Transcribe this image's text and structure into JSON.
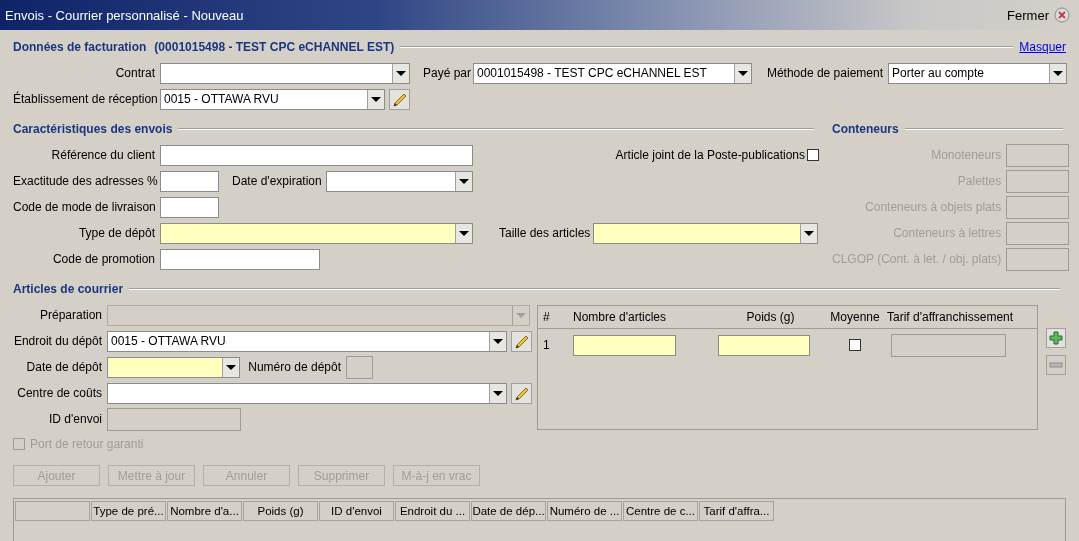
{
  "window": {
    "title": "Envois - Courrier personnalisé - Nouveau",
    "close_label": "Fermer"
  },
  "billing": {
    "heading": "Données de facturation",
    "account": "(0001015498 - TEST CPC eCHANNEL EST)",
    "hide_link": "Masquer",
    "fields": [
      {
        "label": "Contrat",
        "kind": "combo",
        "required": false,
        "disabled": false
      },
      {
        "label": "Payé par",
        "kind": "combo",
        "value": "0001015498 - TEST CPC eCHANNEL EST",
        "required": false,
        "disabled": false
      },
      {
        "label": "Méthode de paiement",
        "kind": "combo",
        "value": "Porter au compte",
        "required": false,
        "disabled": false
      },
      {
        "label": "Établissement de réception",
        "kind": "combo",
        "value": "0015 - OTTAWA RVU",
        "required": false,
        "disabled": false,
        "edit_button": true
      }
    ]
  },
  "shipment": {
    "heading": "Caractéristiques des envois",
    "fields": [
      {
        "label": "Référence du client",
        "kind": "text",
        "required": false,
        "disabled": false
      },
      {
        "label": "Article joint de la Poste-publications",
        "kind": "checkbox",
        "checked": false,
        "disabled": false
      },
      {
        "label": "Exactitude des adresses %",
        "kind": "text",
        "required": false,
        "disabled": false
      },
      {
        "label": "Date d'expiration",
        "kind": "combo",
        "required": false,
        "disabled": false
      },
      {
        "label": "Code de mode de livraison",
        "kind": "text",
        "required": false,
        "disabled": false
      },
      {
        "label": "Type de dépôt",
        "kind": "combo",
        "required": true,
        "disabled": false
      },
      {
        "label": "Taille des articles",
        "kind": "combo",
        "required": true,
        "disabled": false
      },
      {
        "label": "Code de promotion",
        "kind": "text",
        "required": false,
        "disabled": false
      }
    ]
  },
  "containers": {
    "heading": "Conteneurs",
    "disabled": true,
    "fields": [
      {
        "label": "Monoteneurs",
        "kind": "text",
        "required": false,
        "disabled": true
      },
      {
        "label": "Palettes",
        "kind": "text",
        "required": false,
        "disabled": true
      },
      {
        "label": "Conteneurs à objets plats",
        "kind": "text",
        "required": false,
        "disabled": true
      },
      {
        "label": "Conteneurs à lettres",
        "kind": "text",
        "required": false,
        "disabled": true
      },
      {
        "label": "CLGOP (Cont. à let. / obj. plats)",
        "kind": "text",
        "required": false,
        "disabled": true
      }
    ]
  },
  "mail_items": {
    "heading": "Articles de courrier",
    "fields": [
      {
        "label": "Préparation",
        "kind": "combo",
        "required": false,
        "disabled": true
      },
      {
        "label": "Endroit du dépôt",
        "kind": "combo",
        "value": "0015 - OTTAWA RVU",
        "required": false,
        "disabled": false,
        "edit_button": true
      },
      {
        "label": "Date de dépôt",
        "kind": "combo",
        "required": true,
        "disabled": false
      },
      {
        "label": "Numéro de dépôt",
        "kind": "text",
        "required": false,
        "disabled": true
      },
      {
        "label": "Centre de coûts",
        "kind": "combo",
        "required": false,
        "disabled": false,
        "edit_button": true
      },
      {
        "label": "ID d'envoi",
        "kind": "text",
        "required": false,
        "disabled": true
      },
      {
        "label": "Port de retour garanti",
        "kind": "checkbox",
        "checked": false,
        "disabled": true
      }
    ],
    "items_table": {
      "columns": [
        "#",
        "Nombre d'articles",
        "Poids (g)",
        "Moyenne",
        "Tarif d'affranchissement"
      ],
      "rows": [
        {
          "number": "1",
          "count_required": true,
          "weight_required": true,
          "average_checked": false,
          "postage_disabled": true
        }
      ]
    },
    "row_buttons": [
      {
        "kind": "add",
        "disabled": false
      },
      {
        "kind": "remove",
        "disabled": true
      }
    ]
  },
  "actions": [
    {
      "label": "Ajouter",
      "disabled": true
    },
    {
      "label": "Mettre à jour",
      "disabled": true
    },
    {
      "label": "Annuler",
      "disabled": true
    },
    {
      "label": "Supprimer",
      "disabled": true
    },
    {
      "label": "M-à-j en vrac",
      "disabled": true
    }
  ],
  "grid": {
    "columns": [
      "Type de pré...",
      "Nombre d'a...",
      "Poids (g)",
      "ID d'envoi",
      "Endroit du ...",
      "Date de dép...",
      "Numéro de ...",
      "Centre de c...",
      "Tarif d'affra..."
    ]
  }
}
